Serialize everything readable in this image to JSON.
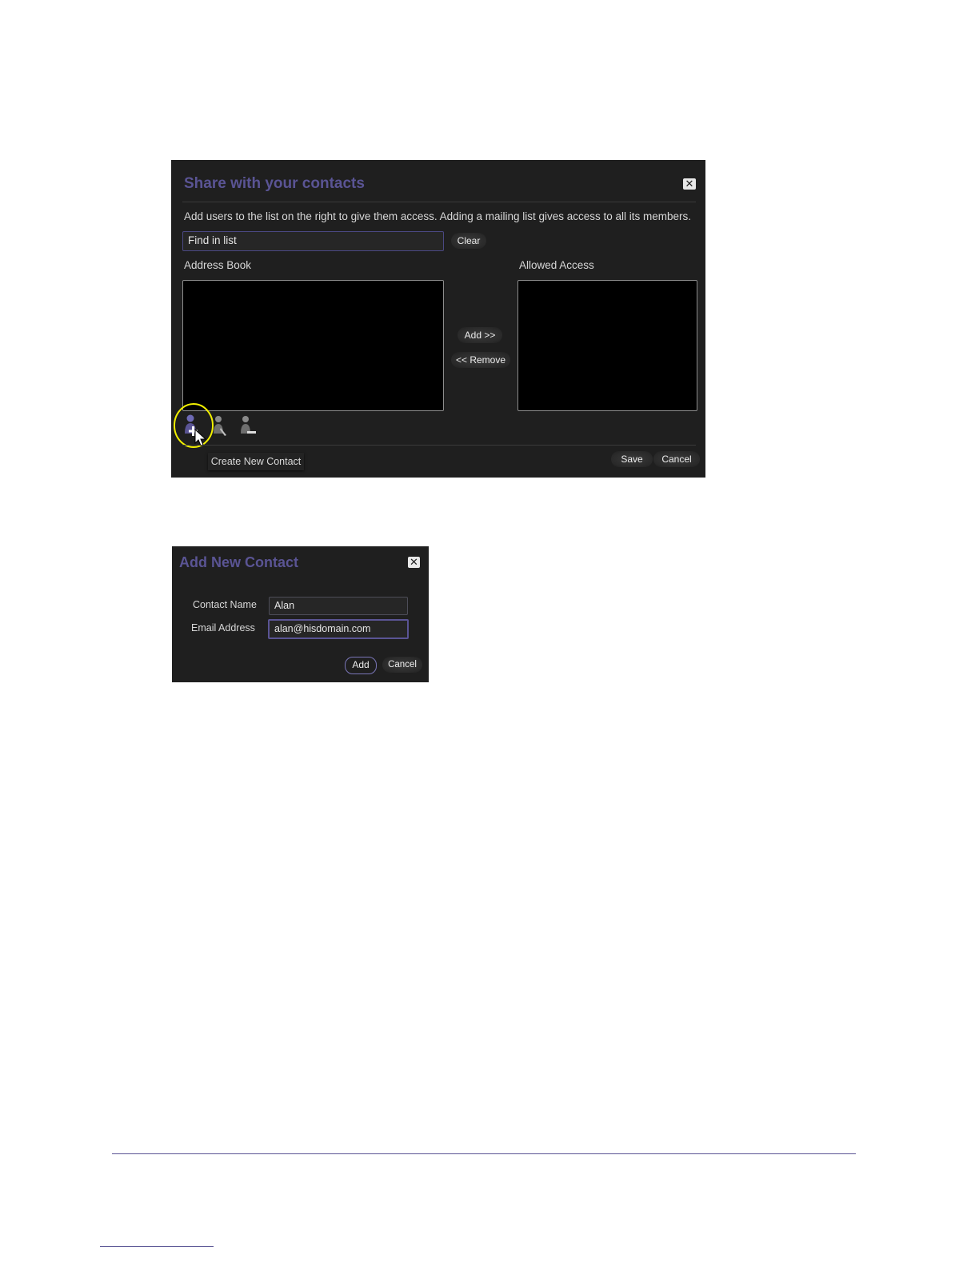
{
  "share_dialog": {
    "title": "Share with your contacts",
    "close_glyph": "✕",
    "instructions": "Add users to the list on the right to give them access. Adding a mailing list gives access to all its members.",
    "find_value": "Find in list",
    "clear_label": "Clear",
    "address_book_label": "Address Book",
    "allowed_access_label": "Allowed Access",
    "add_label": "Add >>",
    "remove_label": "<< Remove",
    "tooltip": "Create New Contact",
    "save_label": "Save",
    "cancel_label": "Cancel",
    "icons": [
      "add-contact-icon",
      "edit-contact-icon",
      "remove-contact-icon",
      "mouse-cursor-icon"
    ],
    "highlight_color": "#f2f000"
  },
  "contact_dialog": {
    "title": "Add New Contact",
    "close_glyph": "✕",
    "contact_name_label": "Contact Name",
    "contact_name_value": "Alan",
    "email_label": "Email Address",
    "email_value": "alan@hisdomain.com",
    "add_label": "Add",
    "cancel_label": "Cancel"
  },
  "colors": {
    "dialog_background": "#1f1f1f",
    "title": "#5a5494",
    "accent_border": "#4a4882",
    "footer_rule": "#5a5494"
  }
}
